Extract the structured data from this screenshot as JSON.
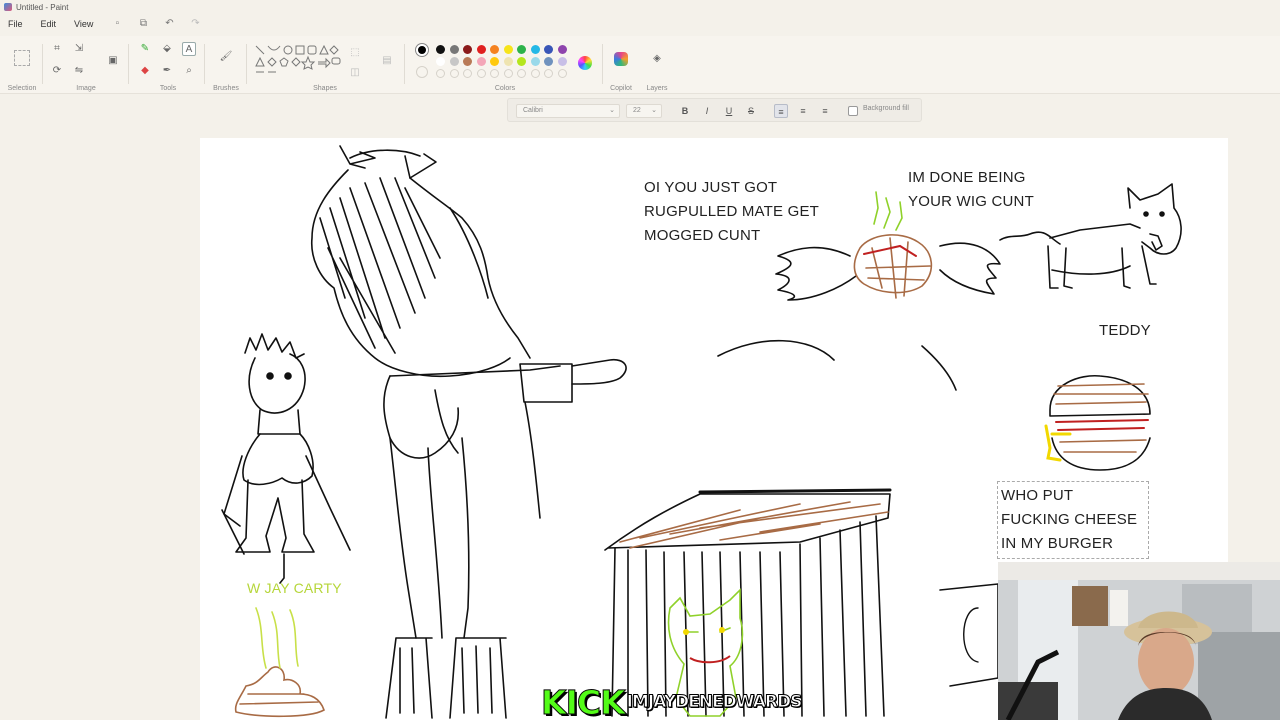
{
  "window": {
    "title": "Untitled - Paint"
  },
  "menu": {
    "file": "File",
    "edit": "Edit",
    "view": "View"
  },
  "ribbon": {
    "groups": {
      "selection": "Selection",
      "image": "Image",
      "tools": "Tools",
      "brushes": "Brushes",
      "shapes": "Shapes",
      "colors": "Colors",
      "copilot": "Copilot",
      "layers": "Layers"
    },
    "palette_row1": [
      "#111111",
      "#777777",
      "#8b1a1a",
      "#e02020",
      "#f58220",
      "#f7e41a",
      "#2db34a",
      "#25b8e6",
      "#3956b7",
      "#8e44ad"
    ],
    "palette_row2": [
      "#ffffff",
      "#c7c7c7",
      "#b97a57",
      "#f4a6b8",
      "#ffc90e",
      "#efe4b0",
      "#b5e61d",
      "#99d9ea",
      "#7092be",
      "#c8bfe7"
    ],
    "current_color": "#000000"
  },
  "text_toolbar": {
    "font": "Calibri",
    "size": "22",
    "bold": "B",
    "italic": "I",
    "underline": "U",
    "strike": "S",
    "background_fill": "Background fill"
  },
  "canvas": {
    "texts": {
      "rugpull_1": "OI YOU JUST GOT",
      "rugpull_2": "RUGPULLED MATE GET",
      "rugpull_3": "MOGGED CUNT",
      "wig_1": "IM DONE BEING",
      "wig_2": "YOUR WIG CUNT",
      "teddy": "TEDDY",
      "burger_1": "WHO PUT",
      "burger_2": "FUCKING CHEESE",
      "burger_3": "IN MY BURGER",
      "wjay": "W JAY CARTY"
    }
  },
  "overlay": {
    "kick_logo": "KICK",
    "kick_handle": "IMJAYDENEDWARDS"
  }
}
